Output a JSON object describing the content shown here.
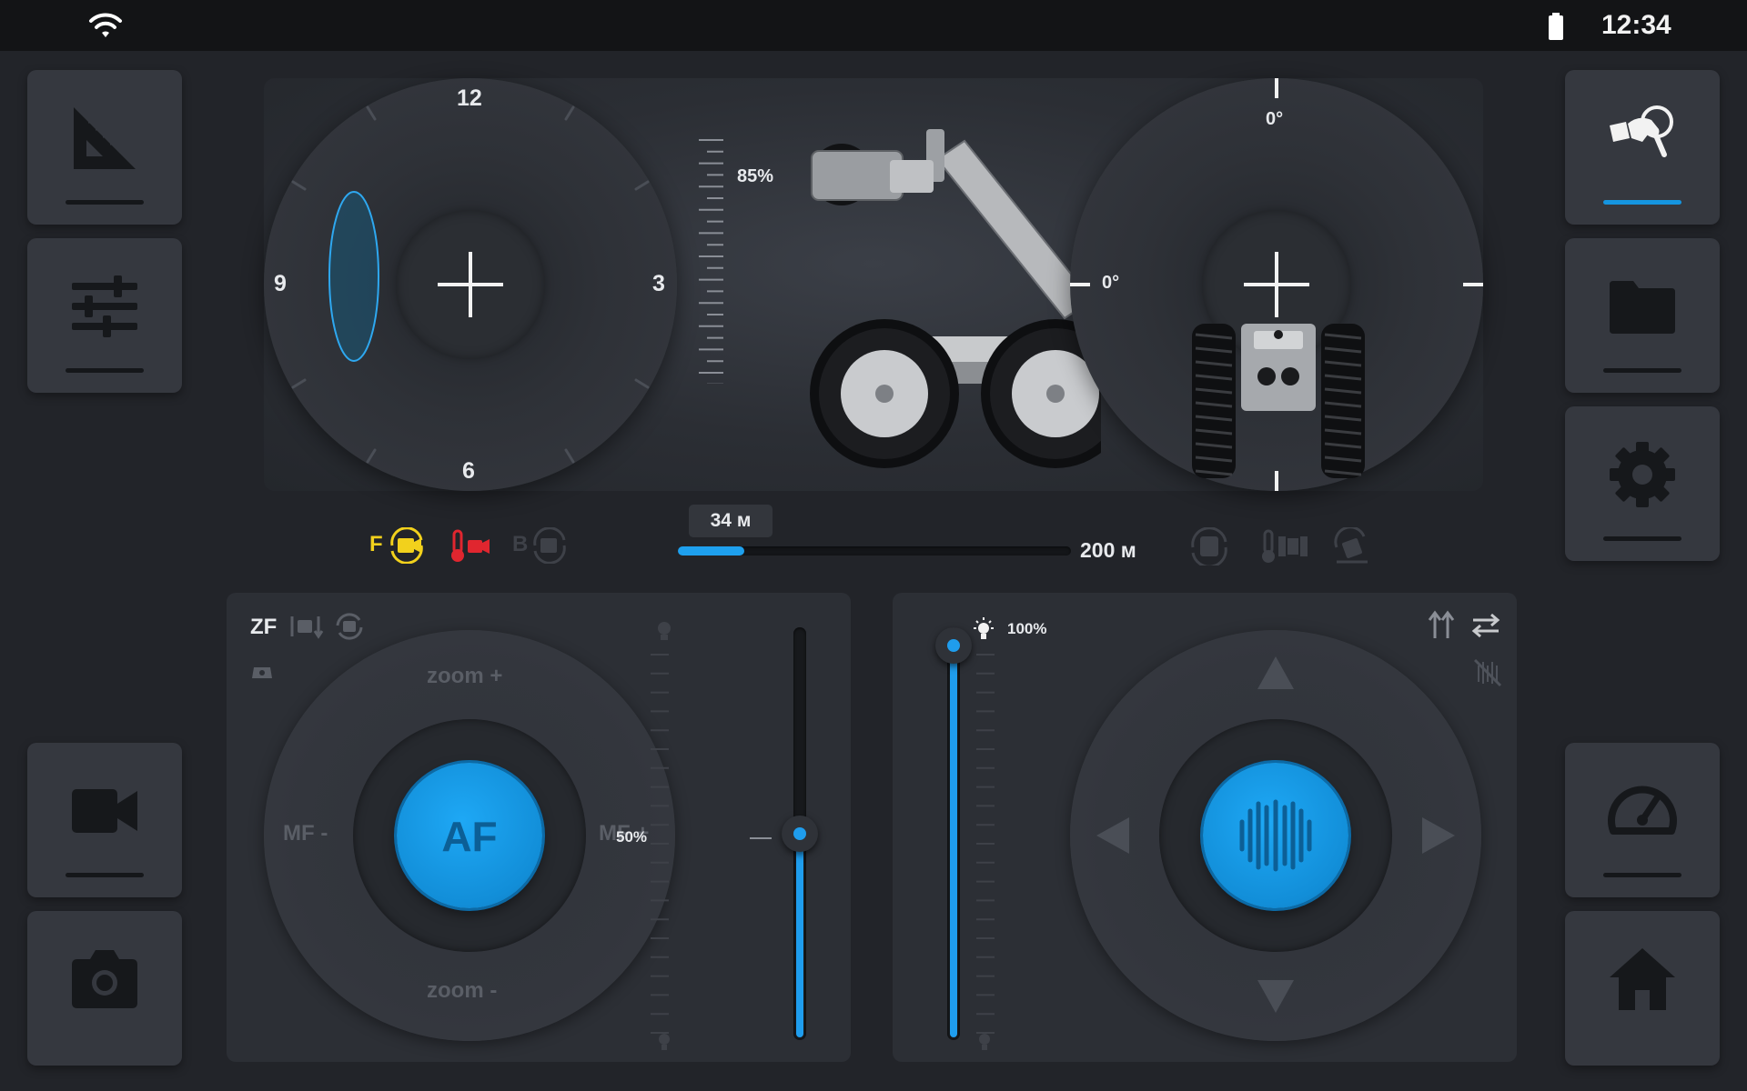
{
  "status_bar": {
    "time": "12:34",
    "wifi_icon": "wifi-icon",
    "battery_icon": "battery-icon"
  },
  "left_sidebar": {
    "buttons": [
      {
        "icon": "set-square-ruler-icon",
        "active": false
      },
      {
        "icon": "sliders-icon",
        "active": false
      },
      {
        "icon": "video-camera-icon",
        "active": false
      },
      {
        "icon": "photo-camera-icon",
        "active": false
      }
    ]
  },
  "right_sidebar": {
    "buttons": [
      {
        "icon": "hand-joystick-icon",
        "active": true
      },
      {
        "icon": "folder-icon",
        "active": false
      },
      {
        "icon": "gear-icon",
        "active": false
      },
      {
        "icon": "speedometer-icon",
        "active": false
      },
      {
        "icon": "home-icon",
        "active": false
      }
    ]
  },
  "camera_rotation_dial": {
    "hour_12": "12",
    "hour_3": "3",
    "hour_6": "6",
    "hour_9": "9"
  },
  "crawler_tilt": {
    "percent": "85%"
  },
  "roll_dial": {
    "top_angle": "0°",
    "left_angle": "0°"
  },
  "camera_status": {
    "front_label": "F",
    "back_label": "B"
  },
  "cable": {
    "current": "34 м",
    "total": "200 м",
    "fraction": 0.17
  },
  "camera_panel": {
    "mode_label": "ZF",
    "zoom_plus": "zoom +",
    "zoom_minus": "zoom -",
    "focus_minus": "MF -",
    "focus_plus": "MF +",
    "autofocus": "AF",
    "light_level": "50%",
    "light_fraction": 0.5
  },
  "drive_panel": {
    "light_level": "100%",
    "light_fraction": 1.0
  },
  "colors": {
    "accent": "#1ea0ee",
    "warning": "#f2d11c",
    "alert": "#e0262f",
    "background": "#222429",
    "panel": "#2c2f35"
  }
}
